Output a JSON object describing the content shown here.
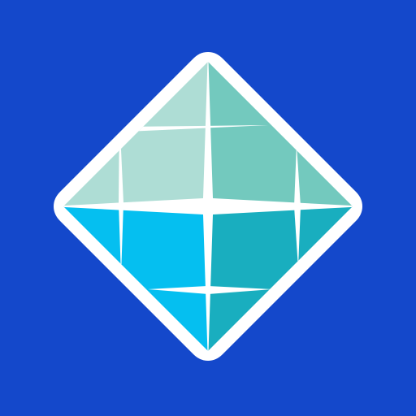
{
  "logo": {
    "icon_name": "crystal-diamond-icon",
    "colors": {
      "background": "#1448CB",
      "outline": "#FFFFFF",
      "top_left": "#AEDDD5",
      "top_right": "#73C9BE",
      "bottom_left": "#05BFF0",
      "bottom_right": "#19AEBF"
    }
  }
}
